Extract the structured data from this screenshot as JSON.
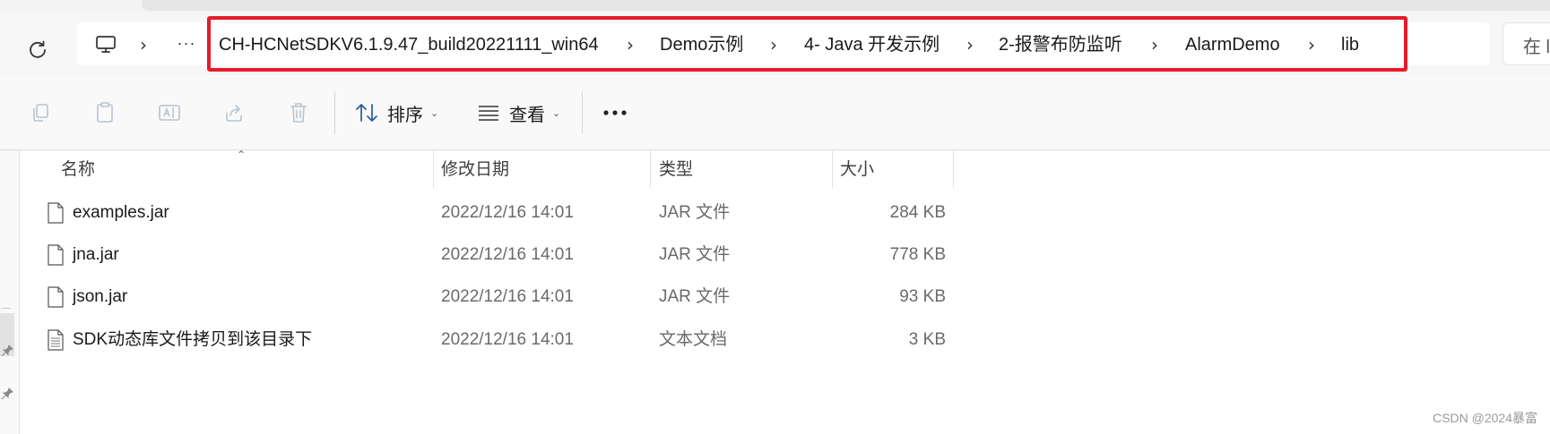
{
  "addressbar": {
    "crumbs": [
      "CH-HCNetSDKV6.1.9.47_build20221111_win64",
      "Demo示例",
      "4- Java 开发示例",
      "2-报警布防监听",
      "AlarmDemo",
      "lib"
    ],
    "overflow_label": "···",
    "search_partial": "在 l"
  },
  "toolbar": {
    "sort_label": "排序",
    "view_label": "查看",
    "more_label": "•••"
  },
  "columns": {
    "name": "名称",
    "date": "修改日期",
    "type": "类型",
    "size": "大小"
  },
  "files": [
    {
      "name": "examples.jar",
      "date": "2022/12/16 14:01",
      "type": "JAR 文件",
      "size": "284 KB",
      "icon": "file-icon"
    },
    {
      "name": "jna.jar",
      "date": "2022/12/16 14:01",
      "type": "JAR 文件",
      "size": "778 KB",
      "icon": "file-icon"
    },
    {
      "name": "json.jar",
      "date": "2022/12/16 14:01",
      "type": "JAR 文件",
      "size": "93 KB",
      "icon": "file-icon"
    },
    {
      "name": "SDK动态库文件拷贝到该目录下",
      "date": "2022/12/16 14:01",
      "type": "文本文档",
      "size": "3 KB",
      "icon": "text-file-icon"
    }
  ],
  "watermark": "CSDN @2024暴富",
  "colors": {
    "highlight": "#e41b2b",
    "toolbar_bg": "#f9f9f9",
    "disabled_icon": "#b8c4d0"
  }
}
